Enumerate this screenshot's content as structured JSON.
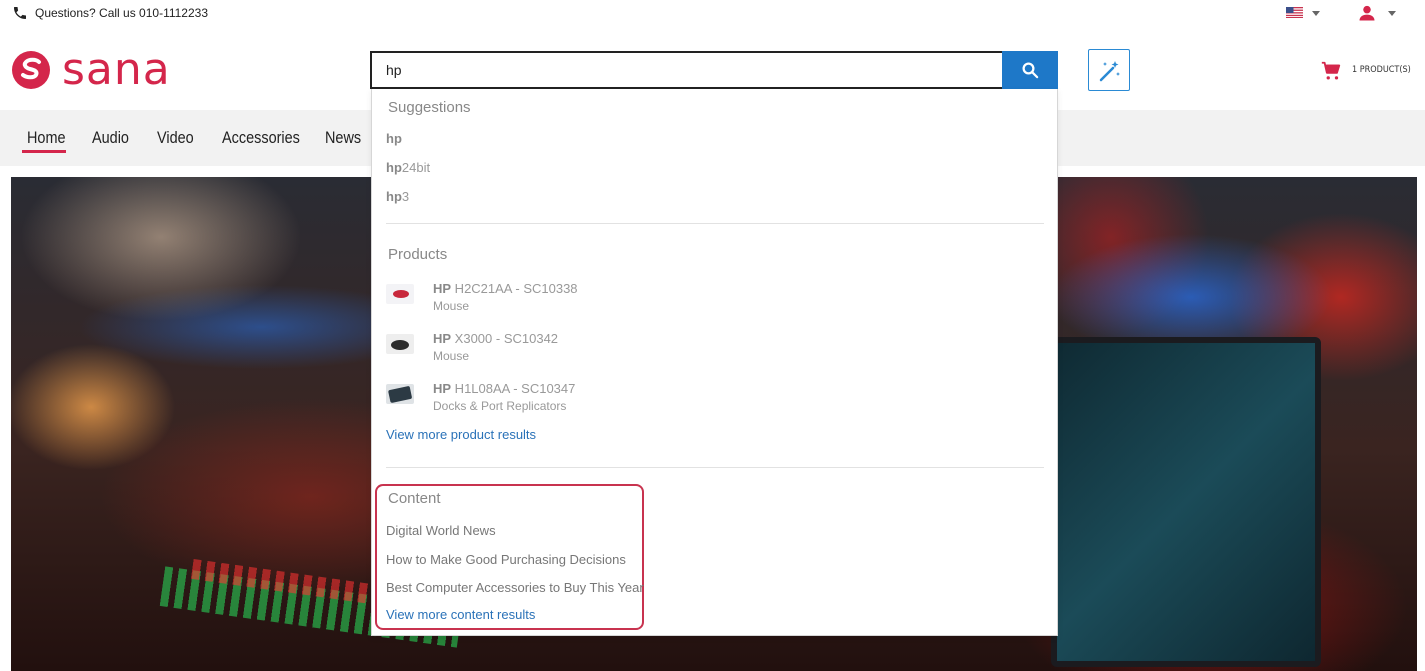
{
  "topbar": {
    "phone_text": "Questions? Call us 010-1112233"
  },
  "header": {
    "logo_text": "sana",
    "brand_color": "#d4264b",
    "search": {
      "value": "hp",
      "button_color": "#1e78c8"
    },
    "cart_text": "1 PRODUCT(S)"
  },
  "nav": {
    "items": [
      "Home",
      "Audio",
      "Video",
      "Accessories",
      "News"
    ],
    "active": "Home"
  },
  "dropdown": {
    "suggestions_title": "Suggestions",
    "suggestions": [
      {
        "match": "hp",
        "rest": ""
      },
      {
        "match": "hp",
        "rest": "24bit"
      },
      {
        "match": "hp",
        "rest": "3"
      }
    ],
    "products_title": "Products",
    "products": [
      {
        "match": "HP",
        "rest": " H2C21AA - SC10338",
        "category": "Mouse"
      },
      {
        "match": "HP",
        "rest": " X3000 - SC10342",
        "category": "Mouse"
      },
      {
        "match": "HP",
        "rest": " H1L08AA - SC10347",
        "category": "Docks & Port Replicators"
      }
    ],
    "more_products": "View more product results",
    "content_title": "Content",
    "content": [
      "Digital World News",
      "How to Make Good Purchasing Decisions",
      "Best Computer Accessories to Buy This Year"
    ],
    "more_content": "View more content results"
  }
}
